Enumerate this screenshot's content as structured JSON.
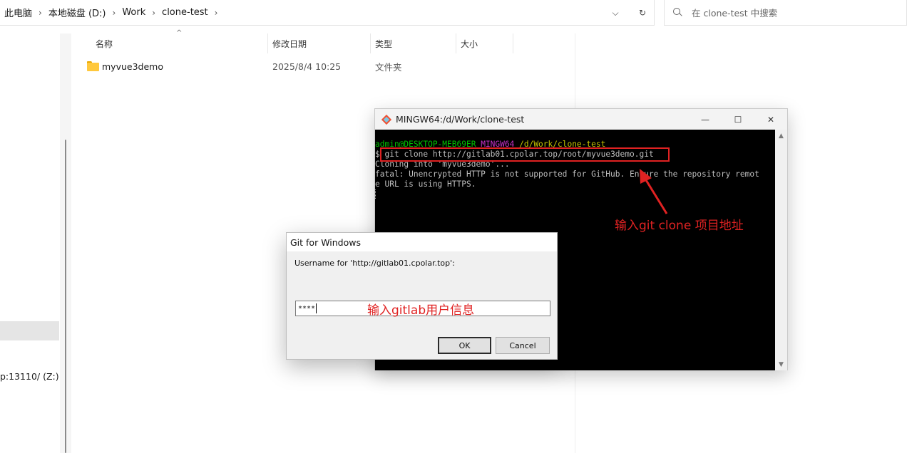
{
  "explorer": {
    "breadcrumbs": [
      "此电脑",
      "本地磁盘 (D:)",
      "Work",
      "clone-test"
    ],
    "breadcrumb_separator": "›",
    "address_dropdown_icon": "chevron-down-icon",
    "refresh_icon": "refresh-icon",
    "search_placeholder": "在 clone-test 中搜索",
    "nav_drive_label": "p:13110/ (Z:)",
    "columns": {
      "name": "名称",
      "modified": "修改日期",
      "type": "类型",
      "size": "大小"
    },
    "sort_indicator": "^",
    "files": [
      {
        "name": "myvue3demo",
        "modified": "2025/8/4 10:25",
        "type": "文件夹",
        "size": ""
      }
    ]
  },
  "terminal": {
    "title": "MINGW64:/d/Work/clone-test",
    "controls": {
      "minimize": "—",
      "maximize": "☐",
      "close": "✕"
    },
    "prompt": {
      "user_host": "admin@DESKTOP-MEB69ER",
      "system": "MINGW64",
      "path": "/d/Work/clone-test"
    },
    "prompt_symbol": "$",
    "command": "git clone http://gitlab01.cpolar.top/root/myvue3demo.git",
    "output_lines": [
      "Cloning into 'myvue3demo'...",
      "fatal: Unencrypted HTTP is not supported for GitHub. Ensure the repository remot",
      "e URL is using HTTPS."
    ],
    "scroll_up": "▲",
    "scroll_down": "▼"
  },
  "annotations": {
    "clone_hint": "输入git clone 项目地址",
    "credential_hint": "输入gitlab用户信息",
    "color": "#e02222"
  },
  "dialog": {
    "title": "Git for Windows",
    "prompt": "Username for 'http://gitlab01.cpolar.top':",
    "input_value": "****",
    "ok_label": "OK",
    "cancel_label": "Cancel"
  }
}
